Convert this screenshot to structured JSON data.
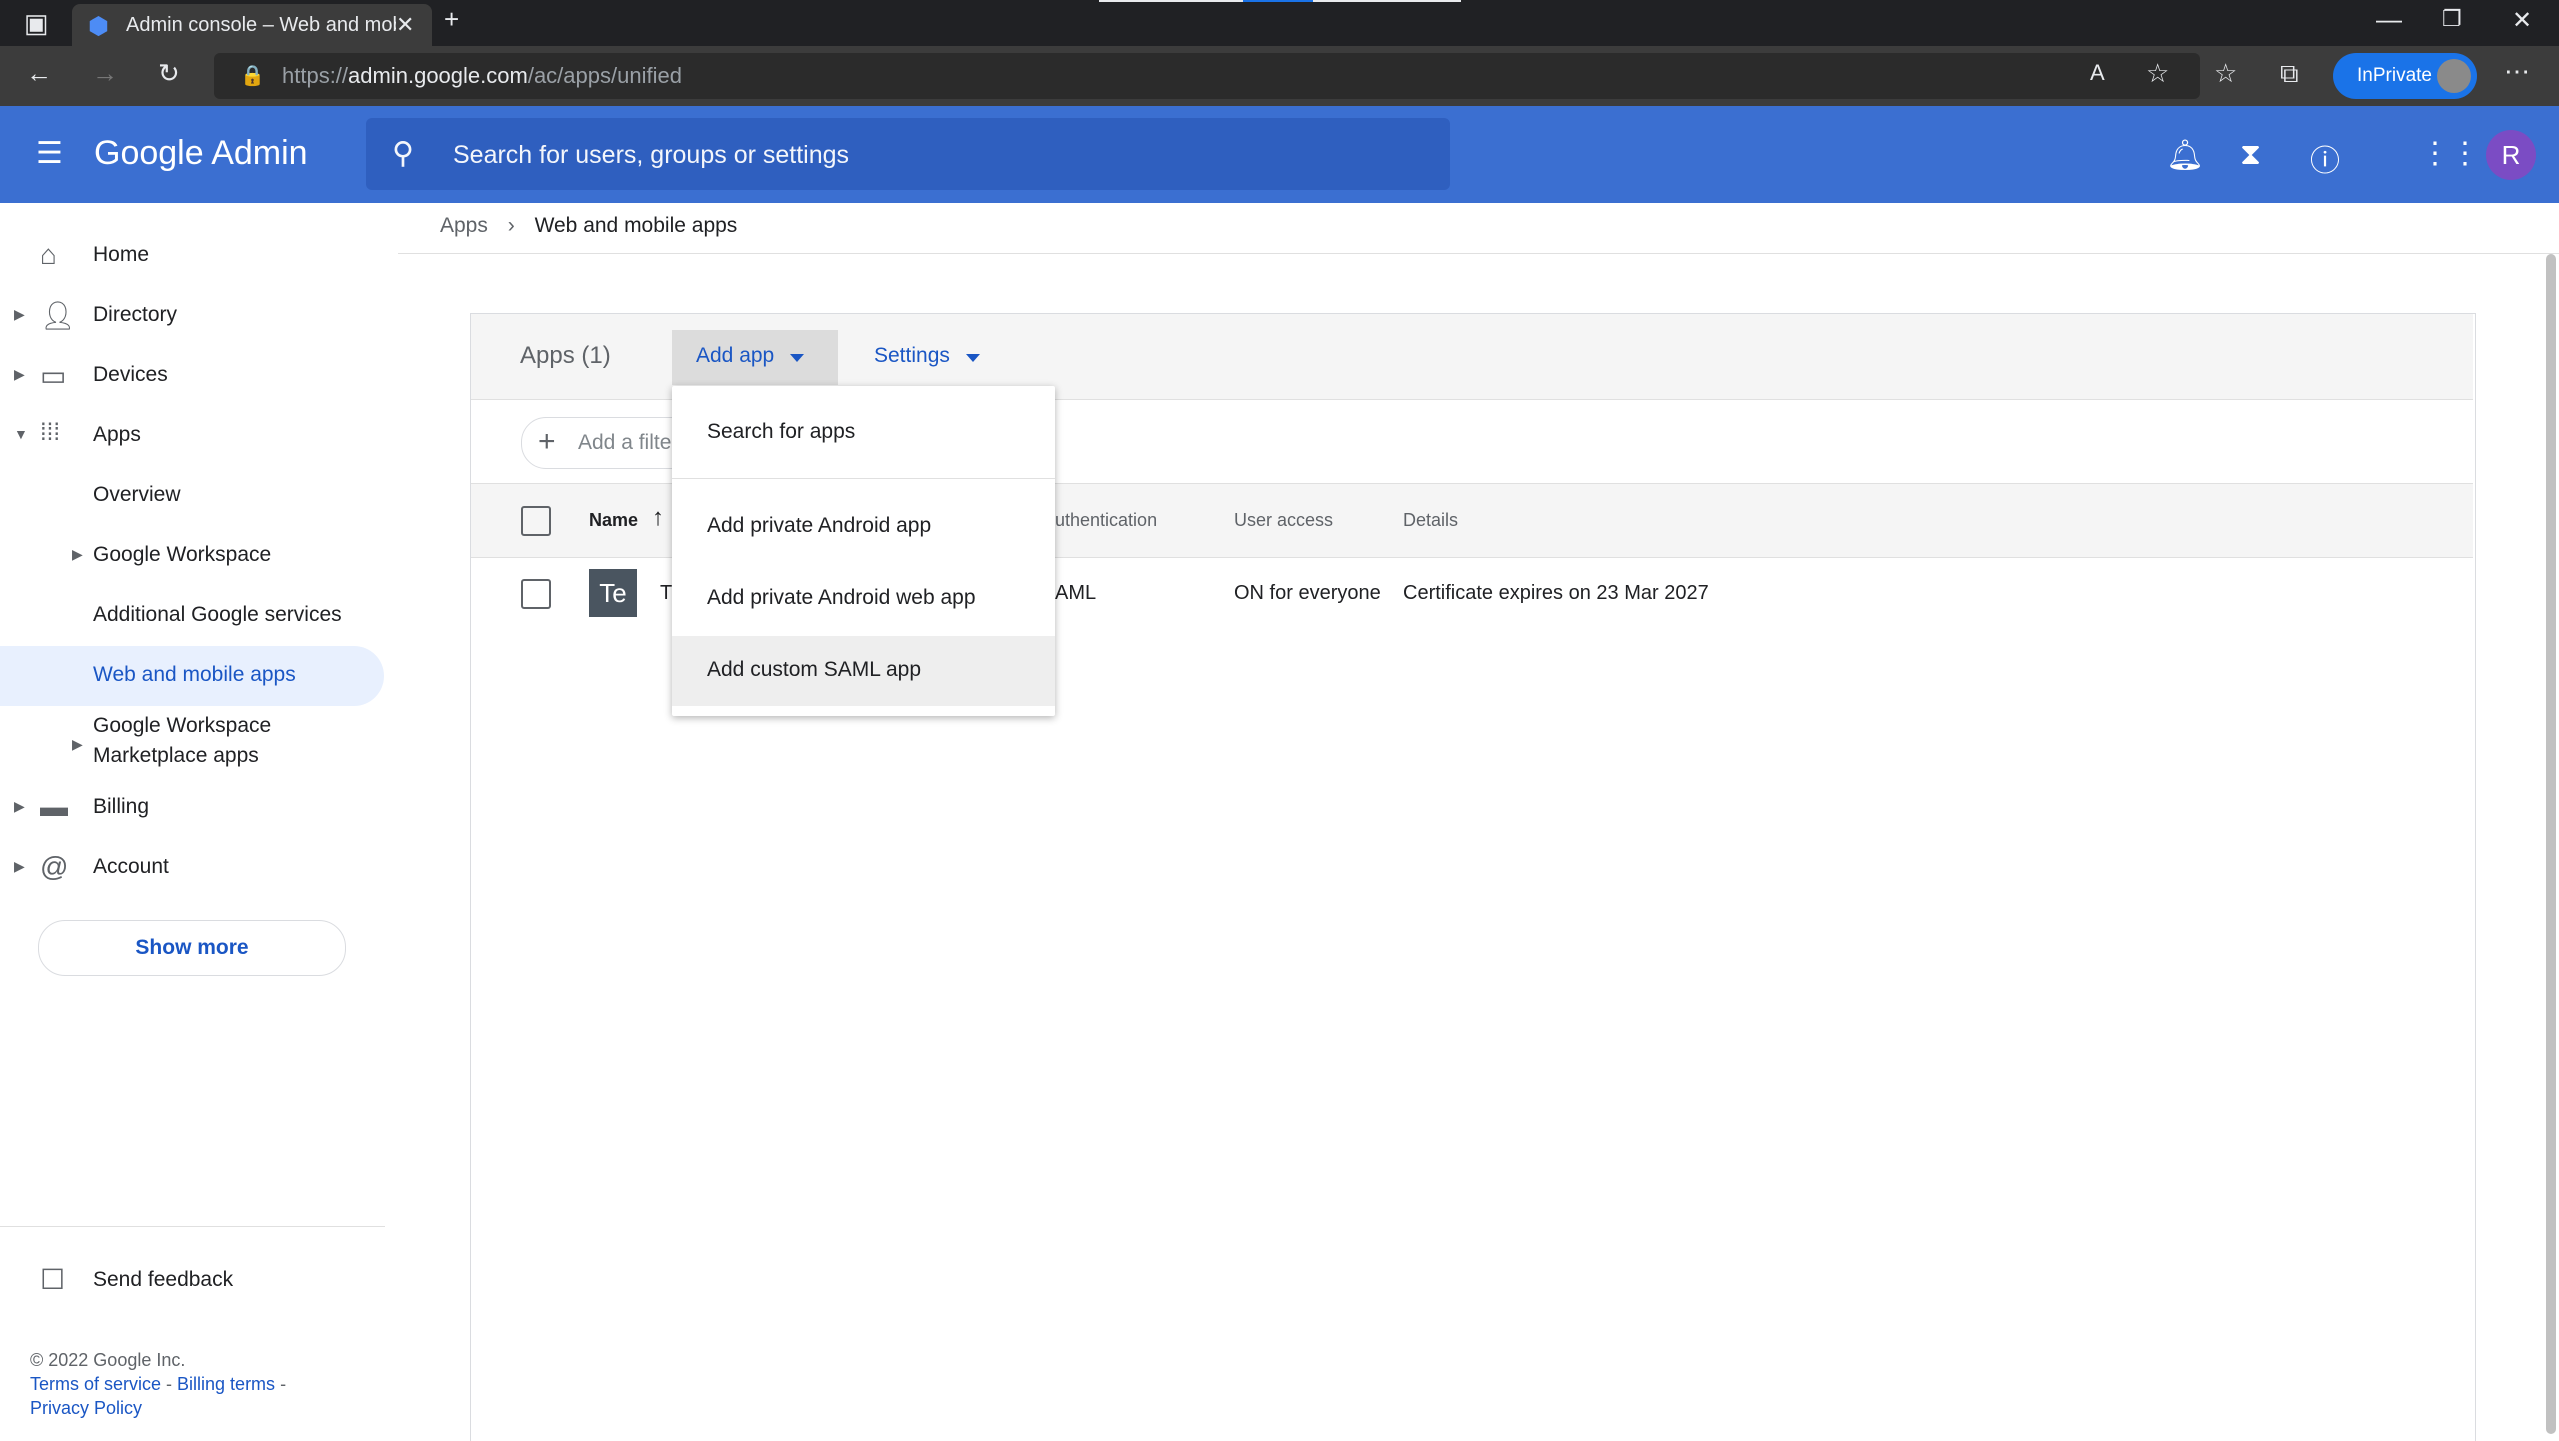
{
  "browser": {
    "tab_title": "Admin console – Web and mobile apps",
    "url_prefix": "https://",
    "url_host": "admin.google.com",
    "url_path": "/ac/apps/unified",
    "inprivate_label": "InPrivate"
  },
  "header": {
    "brand": "Google Admin",
    "search_placeholder": "Search for users, groups or settings",
    "avatar_letter": "R"
  },
  "sidebar": {
    "items": [
      {
        "label": "Home",
        "icon": "home-icon"
      },
      {
        "label": "Directory",
        "icon": "person-icon"
      },
      {
        "label": "Devices",
        "icon": "devices-icon"
      },
      {
        "label": "Apps",
        "icon": "apps-grid-icon"
      },
      {
        "label": "Overview"
      },
      {
        "label": "Google Workspace"
      },
      {
        "label": "Additional Google services"
      },
      {
        "label": "Web and mobile apps"
      },
      {
        "label": "Google Workspace"
      },
      {
        "label": "Marketplace apps"
      },
      {
        "label": "Billing",
        "icon": "billing-card-icon"
      },
      {
        "label": "Account",
        "icon": "account-at-icon"
      }
    ],
    "show_more": "Show more",
    "send_feedback": "Send feedback",
    "copyright": "© 2022 Google Inc.",
    "terms": "Terms of service",
    "billing_terms": "Billing terms",
    "privacy": "Privacy Policy"
  },
  "breadcrumb": {
    "root": "Apps",
    "current": "Web and mobile apps"
  },
  "toolbar": {
    "apps_count": "Apps (1)",
    "add_app": "Add app",
    "settings": "Settings",
    "add_filter": "Add a filte"
  },
  "table": {
    "headers": {
      "name": "Name",
      "authentication": "uthentication",
      "user_access": "User access",
      "details": "Details"
    },
    "rows": [
      {
        "tile": "Te",
        "name": "T",
        "authentication": "AML",
        "user_access": "ON for everyone",
        "details": "Certificate expires on 23 Mar 2027"
      }
    ]
  },
  "add_app_menu": {
    "items": [
      "Search for apps",
      "Add private Android app",
      "Add private Android web app",
      "Add custom SAML app"
    ]
  },
  "colors": {
    "header_blue": "#3b6fd1",
    "link_blue": "#1a56c4"
  }
}
